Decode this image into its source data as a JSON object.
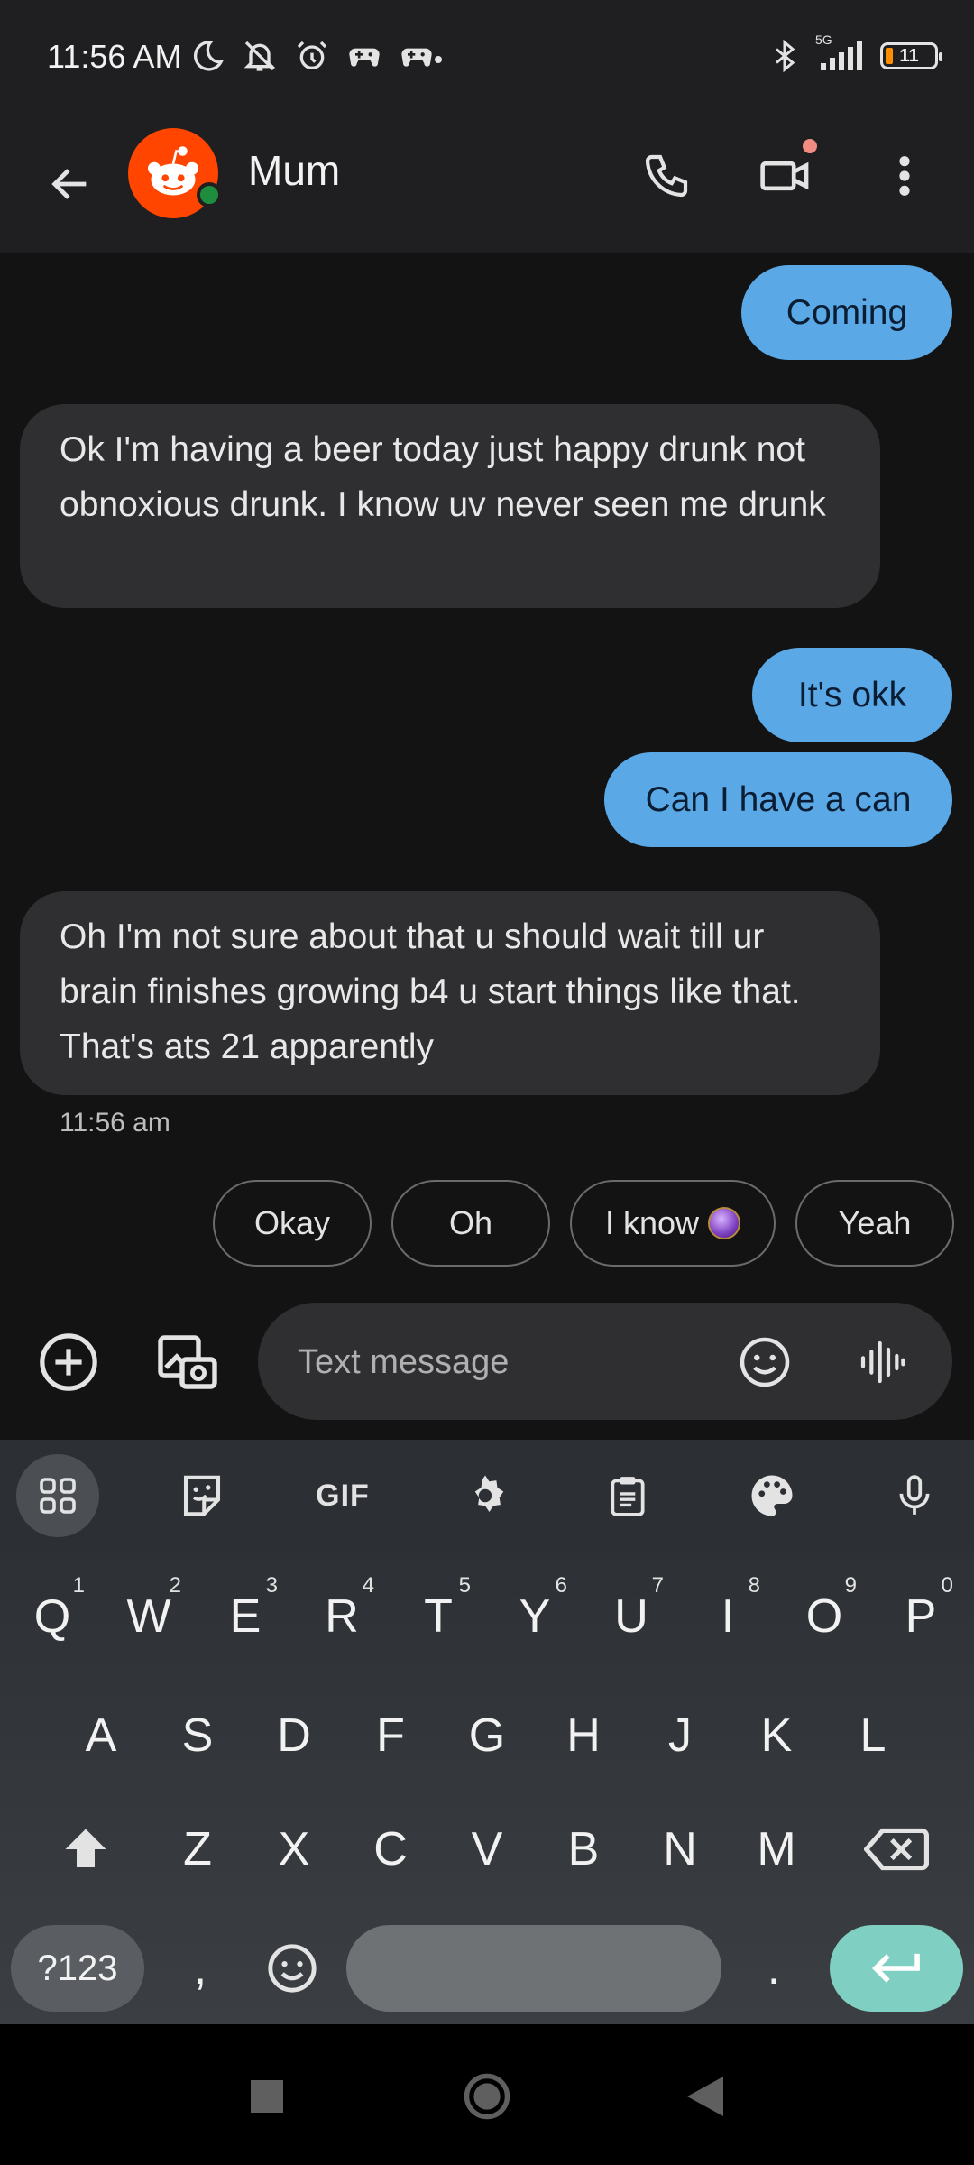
{
  "status_bar": {
    "time": "11:56 AM",
    "network": "5G",
    "battery": "11",
    "icons": [
      "moon-icon",
      "vibrate-off-icon",
      "alarm-icon",
      "game-controller-icon",
      "game-controller-icon",
      "bluetooth-icon",
      "signal-icon",
      "battery-icon"
    ],
    "battery_color": "#ff8f00"
  },
  "header": {
    "contact_name": "Mum",
    "icons": [
      "back-arrow-icon",
      "reddit-avatar-icon",
      "phone-icon",
      "video-call-icon",
      "more-vert-icon"
    ],
    "video_dot_color": "#f28b82"
  },
  "conversation": {
    "messages": [
      {
        "direction": "outgoing",
        "text": "Coming"
      },
      {
        "direction": "incoming",
        "text": "Ok I'm having a beer today just happy drunk not obnoxious drunk. I know uv never seen me drunk"
      },
      {
        "direction": "outgoing",
        "text": "It's okk"
      },
      {
        "direction": "outgoing",
        "text": "Can I have a can"
      },
      {
        "direction": "incoming",
        "text": "Oh I'm not sure about that u should wait till ur brain finishes growing b4  u start things like that. That's ats 21 apparently"
      }
    ],
    "last_timestamp": "11:56 am",
    "outgoing_color": "#5aa9e6",
    "incoming_color": "#2f2f31"
  },
  "smart_replies": [
    "Okay",
    "Oh",
    "I know",
    "Yeah"
  ],
  "compose": {
    "placeholder": "Text message",
    "icons": [
      "add-circle-icon",
      "gallery-camera-icon",
      "emoji-icon",
      "voice-waveform-icon"
    ]
  },
  "keyboard": {
    "toolbar": {
      "gif_label": "GIF",
      "icons": [
        "apps-grid-icon",
        "sticker-icon",
        "gif-icon",
        "settings-gear-icon",
        "clipboard-icon",
        "palette-icon",
        "microphone-icon"
      ]
    },
    "row1": [
      {
        "key": "Q",
        "hint": "1"
      },
      {
        "key": "W",
        "hint": "2"
      },
      {
        "key": "E",
        "hint": "3"
      },
      {
        "key": "R",
        "hint": "4"
      },
      {
        "key": "T",
        "hint": "5"
      },
      {
        "key": "Y",
        "hint": "6"
      },
      {
        "key": "U",
        "hint": "7"
      },
      {
        "key": "I",
        "hint": "8"
      },
      {
        "key": "O",
        "hint": "9"
      },
      {
        "key": "P",
        "hint": "0"
      }
    ],
    "row2": [
      "A",
      "S",
      "D",
      "F",
      "G",
      "H",
      "J",
      "K",
      "L"
    ],
    "row3": [
      "Z",
      "X",
      "C",
      "V",
      "B",
      "N",
      "M"
    ],
    "bottom": {
      "symbols_label": "?123",
      "comma": ",",
      "period": "."
    },
    "enter_color": "#7fcfc3"
  },
  "nav_bar": {
    "icons": [
      "recents-square-icon",
      "home-circle-icon",
      "back-triangle-icon"
    ]
  }
}
